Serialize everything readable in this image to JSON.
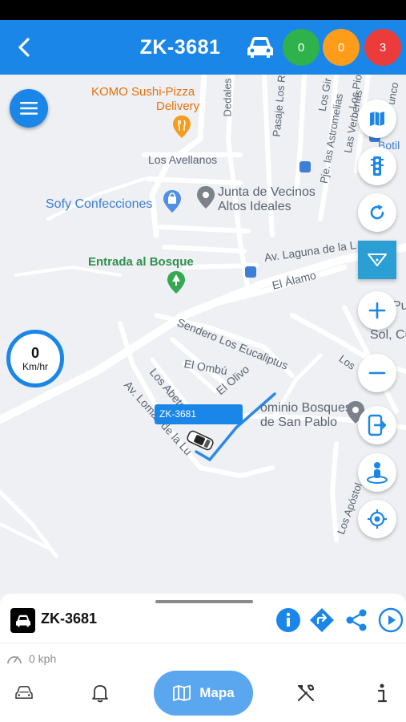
{
  "header": {
    "title": "ZK-3681",
    "counts": [
      {
        "value": "0",
        "color": "#2fb14c"
      },
      {
        "value": "0",
        "color": "#ff9d1b"
      },
      {
        "value": "3",
        "color": "#ec3b3b"
      }
    ]
  },
  "map": {
    "pois": {
      "komo_line1": "KOMO Sushi-Pizza",
      "komo_line2": "Delivery",
      "sofy": "Sofy Confecciones",
      "junta_line1": "Junta de Vecinos",
      "junta_line2": "Altos Ideales",
      "entrada": "Entrada al Bosque",
      "condominio_line1": "ominio Bosques",
      "condominio_line2": "de San Pablo",
      "edge_line1": "Pu",
      "edge_line2": "Sol, Cu",
      "edge_botil": "Botil"
    },
    "streets": {
      "avellanos": "Los Avellanos",
      "laguna": "Av. Laguna de la L",
      "alamo": "El Álamo",
      "sendero": "Sendero Los Eucaliptus",
      "ombu": "El Ombú",
      "olivo": "El Olivo",
      "abetos": "Los Abetos",
      "lomas": "Av. Lomas de la Lu",
      "dedales": "Dedales",
      "rosales": "Pasaje Los Ros",
      "astromelias": "Pje. las Astromelias",
      "verbenas": "Las Verbenas",
      "gir": "Los Gir",
      "pior": "Los Pior",
      "unco": "unco",
      "apost": "Los Apóstol",
      "los_small": "Los"
    },
    "speedometer": {
      "value": "0",
      "unit": "Km/hr"
    },
    "vehicle_label": "ZK-3681"
  },
  "panel": {
    "title": "ZK-3681",
    "speed": "0 kph"
  },
  "tabs": {
    "active_label": "Mapa"
  },
  "colors": {
    "brand": "#1a86e8",
    "route": "#2b8ae6"
  }
}
